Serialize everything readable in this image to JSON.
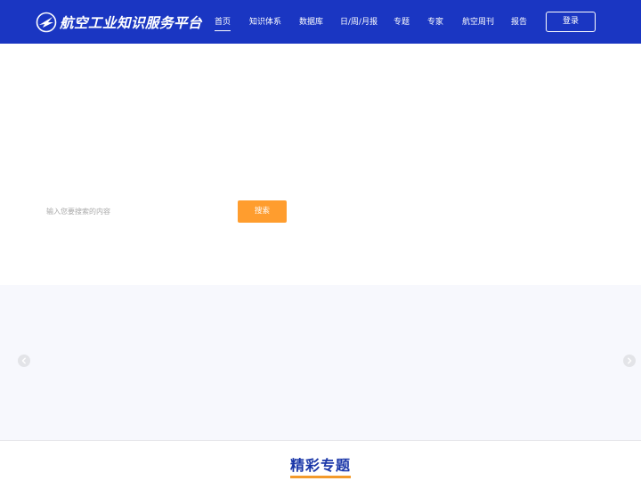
{
  "header": {
    "site_title": "航空工业知识服务平台",
    "nav": [
      {
        "label": "首页",
        "active": true
      },
      {
        "label": "知识体系"
      },
      {
        "label": "数据库"
      },
      {
        "label": "日/周/月报"
      },
      {
        "label": "专题"
      },
      {
        "label": "专家"
      },
      {
        "label": "航空周刊"
      },
      {
        "label": "报告"
      }
    ],
    "login_label": "登录"
  },
  "search": {
    "placeholder": "输入您要搜索的内容",
    "button_label": "搜索"
  },
  "carousel": {
    "prev_icon": "chevron-left-icon",
    "next_icon": "chevron-right-icon"
  },
  "section": {
    "title": "精彩专题"
  },
  "colors": {
    "header_bg": "#1a36c2",
    "search_button": "#ff9d2e",
    "section_title": "#1a36a8",
    "title_underline": "#f39a2b",
    "carousel_bg": "#f7f8fd"
  }
}
